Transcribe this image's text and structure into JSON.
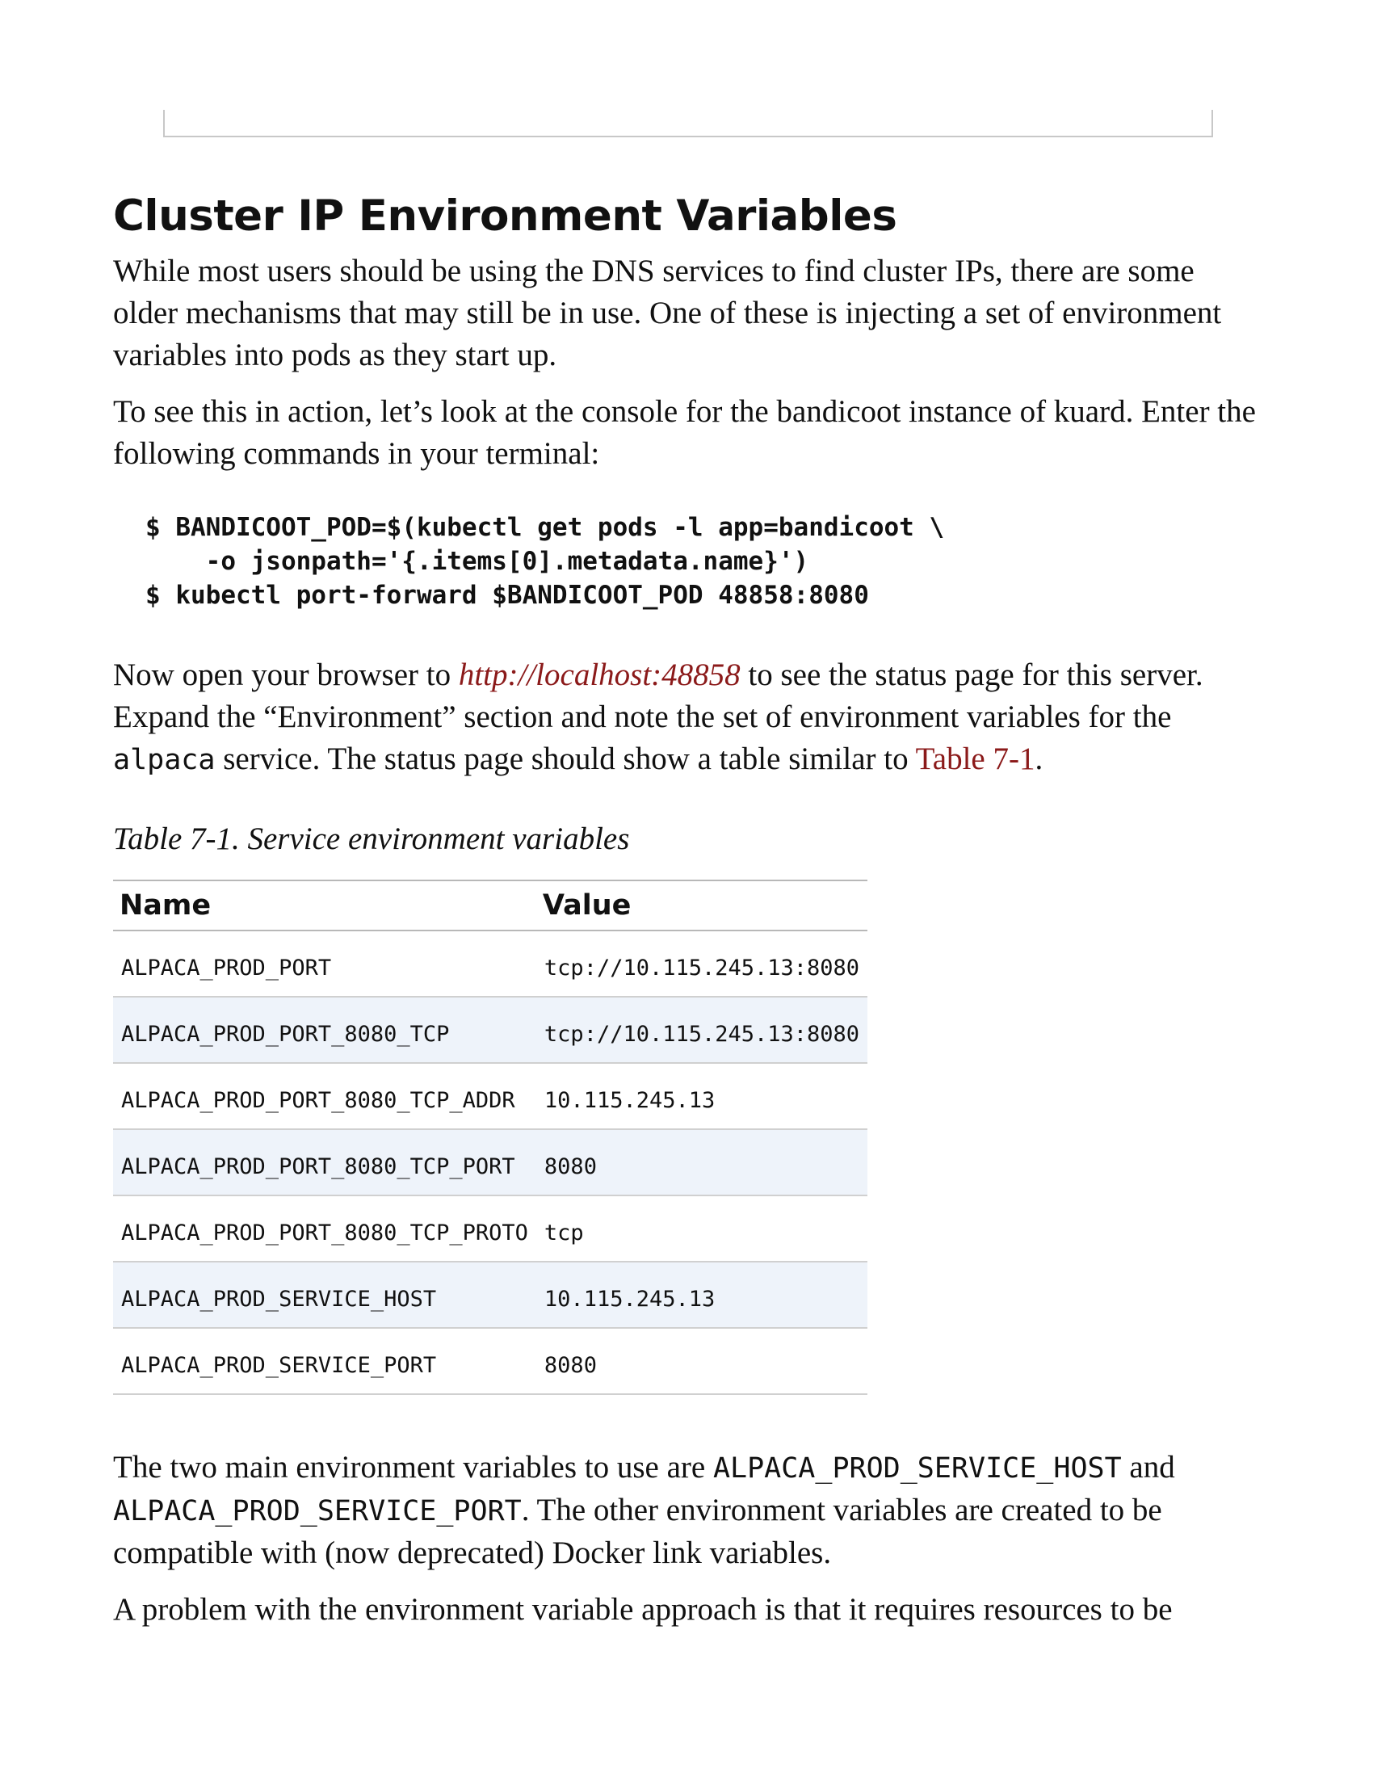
{
  "heading": "Cluster IP Environment Variables",
  "para1": "While most users should be using the DNS services to find cluster IPs, there are some older mechanisms that may still be in use. One of these is injecting a set of environment variables into pods as they start up.",
  "para2": "To see this in action, let’s look at the console for the bandicoot instance of kuard. Enter the following commands in your terminal:",
  "code_lines": [
    "$ BANDICOOT_POD=$(kubectl get pods -l app=bandicoot \\",
    "    -o jsonpath='{.items[0].metadata.name}')",
    "$ kubectl port-forward $BANDICOOT_POD 48858:8080"
  ],
  "para3": {
    "part1": "Now open your browser to ",
    "link": "http://localhost:48858",
    "part2": " to see the status page for this server. Expand the “Environment” section and note the set of environment variables for the ",
    "code": "alpaca",
    "part3": " service. The status page should show a table similar to ",
    "table_ref": "Table 7-1",
    "part4": "."
  },
  "table": {
    "caption": "Table 7-1. Service environment variables",
    "headers": [
      "Name",
      "Value"
    ],
    "rows": [
      {
        "name": "ALPACA_PROD_PORT",
        "value": "tcp://10.115.245.13:8080"
      },
      {
        "name": "ALPACA_PROD_PORT_8080_TCP",
        "value": "tcp://10.115.245.13:8080"
      },
      {
        "name": "ALPACA_PROD_PORT_8080_TCP_ADDR",
        "value": "10.115.245.13"
      },
      {
        "name": "ALPACA_PROD_PORT_8080_TCP_PORT",
        "value": "8080"
      },
      {
        "name": "ALPACA_PROD_PORT_8080_TCP_PROTO",
        "value": "tcp"
      },
      {
        "name": "ALPACA_PROD_SERVICE_HOST",
        "value": "10.115.245.13"
      },
      {
        "name": "ALPACA_PROD_SERVICE_PORT",
        "value": "8080"
      }
    ]
  },
  "para4": {
    "part1": "The two main environment variables to use are ",
    "code1": "ALPACA_PROD_SERVICE_HOST",
    "part2": " and ",
    "code2": "ALPACA_PROD_SERVICE_PORT",
    "part3": ". The other environment variables are created to be compatible with (now deprecated) Docker link variables."
  },
  "para5": "A problem with the environment variable approach is that it requires resources to be"
}
